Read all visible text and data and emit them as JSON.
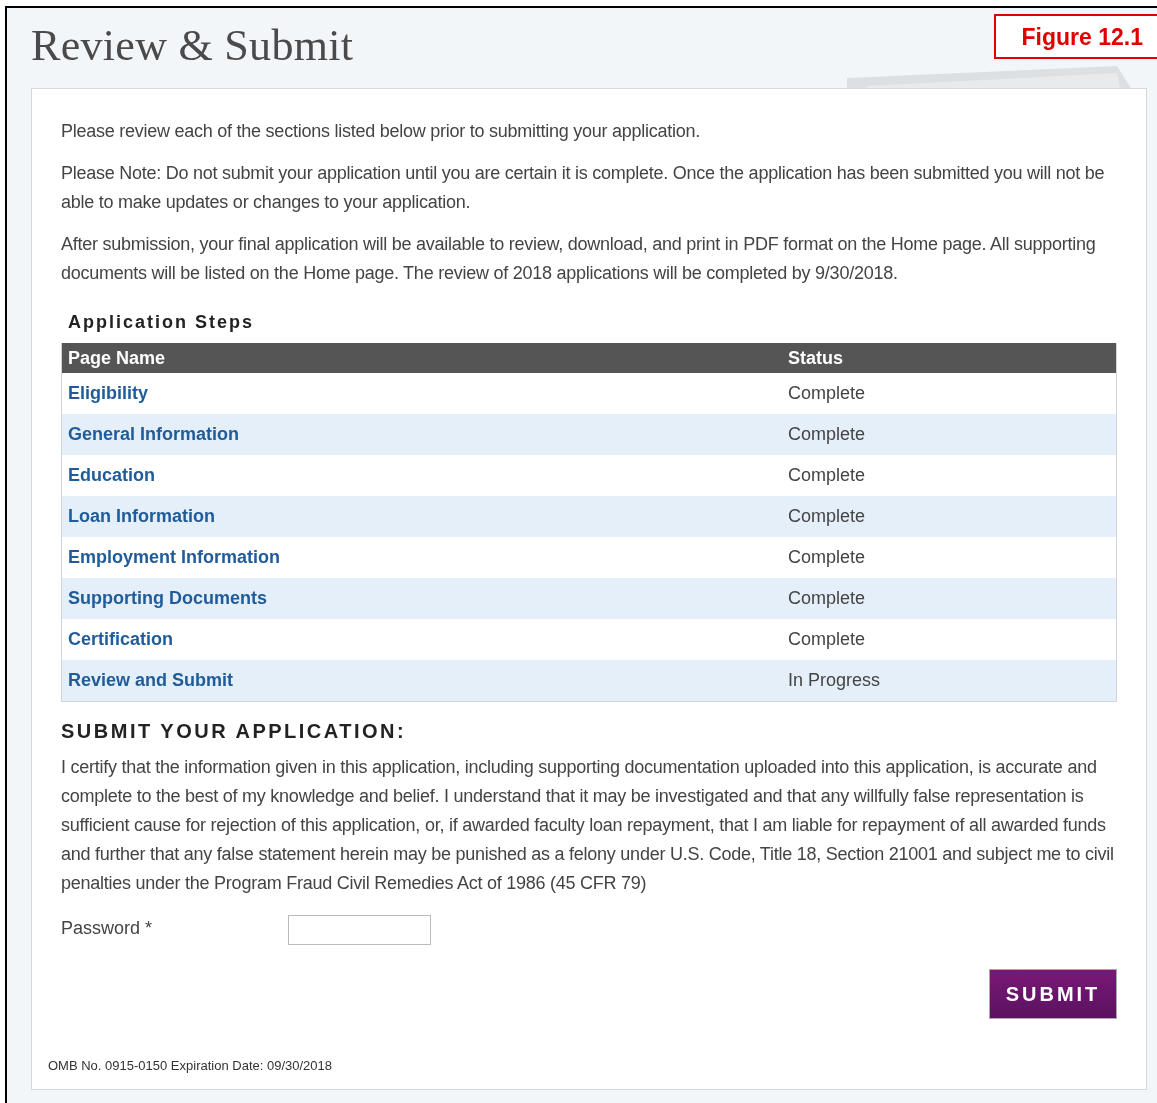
{
  "title": "Review & Submit",
  "figure_label": "Figure 12.1",
  "intro": [
    "Please review each of the sections listed below prior to submitting your application.",
    "Please Note: Do not submit your application until you are certain it is complete. Once the application has been submitted you will not be able to make updates or changes to your application.",
    "After submission, your final application will be available to review, download, and print in PDF format on the Home page. All supporting documents will be listed on the Home page. The review of 2018 applications will be completed by 9/30/2018."
  ],
  "steps": {
    "heading": "Application Steps",
    "columns": [
      "Page Name",
      "Status"
    ],
    "rows": [
      {
        "page": "Eligibility",
        "status": "Complete"
      },
      {
        "page": "General Information",
        "status": "Complete"
      },
      {
        "page": "Education",
        "status": "Complete"
      },
      {
        "page": "Loan Information",
        "status": "Complete"
      },
      {
        "page": "Employment Information",
        "status": "Complete"
      },
      {
        "page": "Supporting Documents",
        "status": "Complete"
      },
      {
        "page": "Certification",
        "status": "Complete"
      },
      {
        "page": "Review and Submit",
        "status": "In Progress"
      }
    ]
  },
  "submit_section": {
    "heading": "SUBMIT YOUR APPLICATION:",
    "certification": "I certify that the information given in this application, including supporting documentation uploaded into this application, is accurate and complete to the best of my knowledge and belief. I understand that it may be investigated and that any willfully false representation is sufficient cause for rejection of this application, or, if awarded faculty loan repayment, that I am liable for repayment of all awarded funds and further that any false statement herein may be punished as a felony under U.S. Code, Title 18, Section 21001 and subject me to civil penalties under the Program Fraud Civil Remedies Act of 1986 (45 CFR 79)",
    "password_label": "Password *",
    "button": "SUBMIT"
  },
  "footer": "OMB No. 0915-0150 Expiration Date: 09/30/2018"
}
